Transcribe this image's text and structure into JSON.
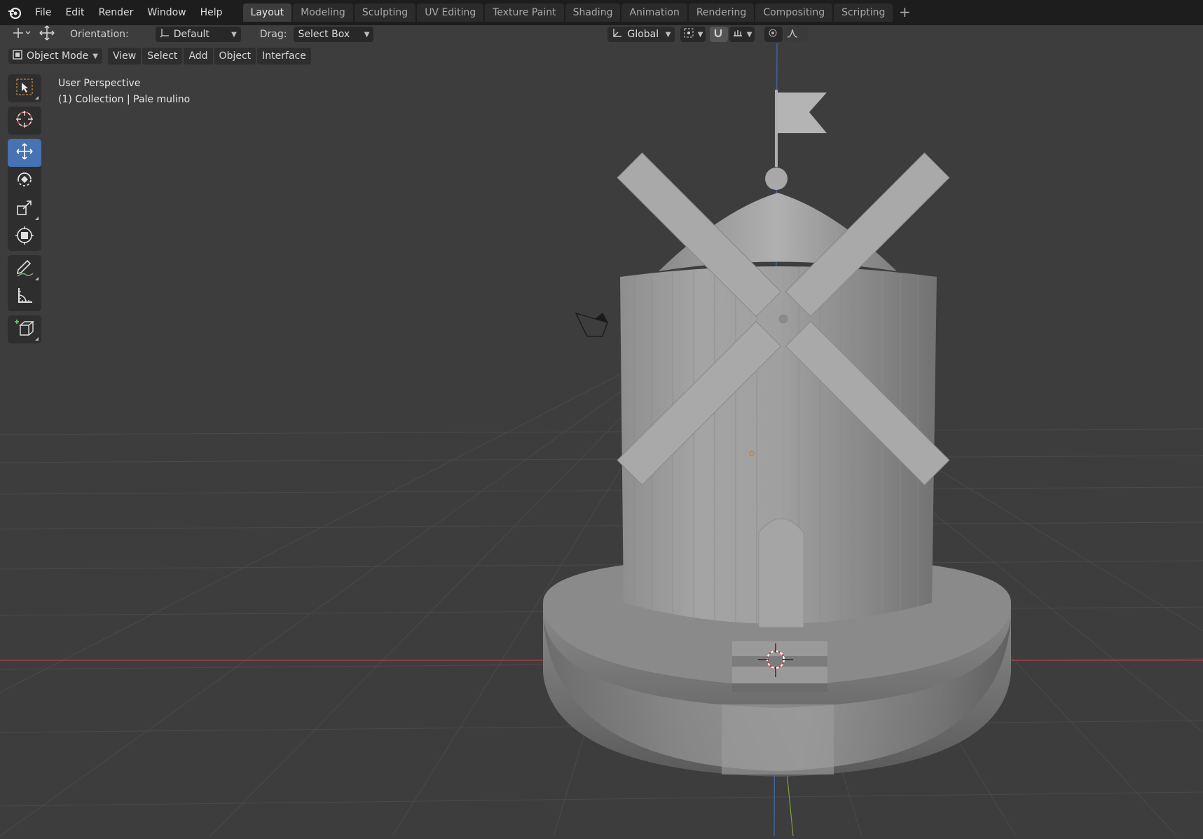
{
  "menu": {
    "items": [
      "File",
      "Edit",
      "Render",
      "Window",
      "Help"
    ]
  },
  "workspaces": {
    "tabs": [
      "Layout",
      "Modeling",
      "Sculpting",
      "UV Editing",
      "Texture Paint",
      "Shading",
      "Animation",
      "Rendering",
      "Compositing",
      "Scripting"
    ],
    "active": "Layout",
    "add_label": "+"
  },
  "tool_header": {
    "orientation_label": "Orientation:",
    "orientation_value": "Default",
    "drag_label": "Drag:",
    "drag_value": "Select Box",
    "transform_orientation": "Global"
  },
  "mode_header": {
    "mode": "Object Mode",
    "menus": [
      "View",
      "Select",
      "Add",
      "Object",
      "Interface"
    ]
  },
  "viewport": {
    "view_name": "User Perspective",
    "collection_info": "(1) Collection | Pale mulino"
  },
  "toolbar": {
    "tools": [
      "select-box",
      "cursor",
      "move",
      "rotate",
      "scale",
      "transform",
      "annotate",
      "measure",
      "add-cube"
    ],
    "active_tool": "move"
  },
  "colors": {
    "accent": "#4772b3",
    "x_axis": "#b5404a",
    "y_axis": "#7fa03a",
    "z_axis": "#3e6bb0"
  }
}
